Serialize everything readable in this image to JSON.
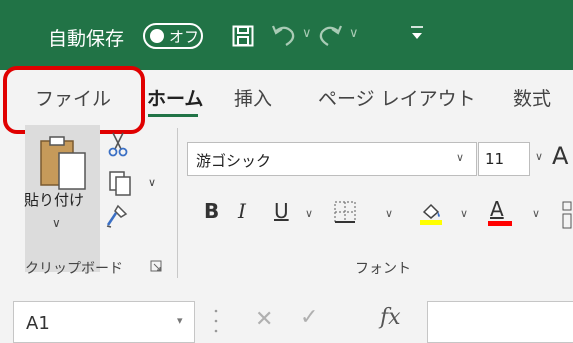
{
  "title_bar": {
    "autosave_label": "自動保存",
    "autosave_state": "オフ",
    "icons": [
      "save-icon",
      "undo-icon",
      "redo-icon",
      "customize-qat-icon"
    ],
    "background_color": "#217346"
  },
  "tabs": [
    {
      "label": "ファイル"
    },
    {
      "label": "ホーム",
      "active": true
    },
    {
      "label": "挿入"
    },
    {
      "label": "ページ レイアウト"
    },
    {
      "label": "数式"
    }
  ],
  "ribbon": {
    "clipboard": {
      "paste_label": "貼り付け",
      "group_label": "クリップボード"
    },
    "font": {
      "font_name": "游ゴシック",
      "font_size": "11",
      "bold": "B",
      "italic": "I",
      "underline": "U",
      "font_color_glyph": "A",
      "grow_font_glyph": "A",
      "group_label": "フォント",
      "fill_color": "#ffff00",
      "font_color": "#ff0000"
    }
  },
  "formula_bar": {
    "name_box": "A1",
    "fx_label": "fx",
    "formula": ""
  },
  "highlight": {
    "target": "tab-file",
    "color": "#e00000"
  }
}
